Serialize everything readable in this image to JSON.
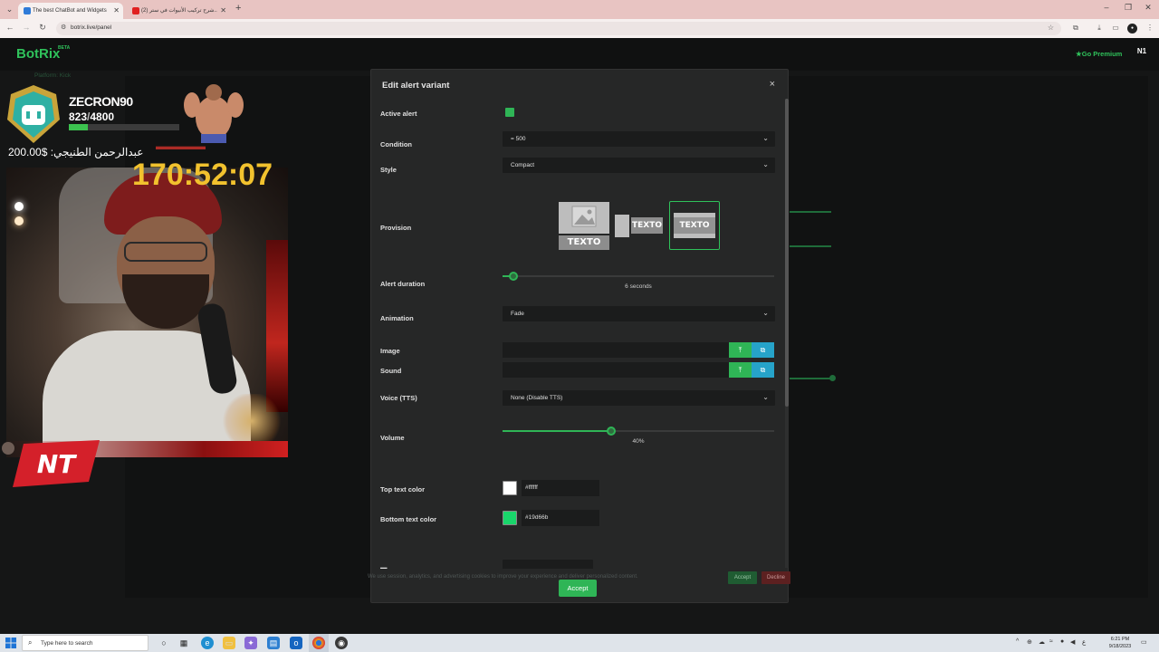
{
  "browser": {
    "tabs": [
      {
        "title": "The best ChatBot and Widgets",
        "active": true
      },
      {
        "title": "(2) شرح تركيب الأنيوات في ستر...",
        "active": false
      }
    ],
    "url": "botrix.live/panel"
  },
  "page": {
    "logo": "BotRix",
    "logo_badge": "BETA",
    "go_premium": "Go Premium",
    "platform_line": "Platform: Kick"
  },
  "stream_overlay": {
    "username": "ZECRON90",
    "xp_current": "823",
    "xp_total": "4800",
    "xp_fraction": 0.17,
    "donation": "عبدالرحمن الطنيجي: $200.00",
    "timer": "170:52:07",
    "nt_logo": "NT"
  },
  "modal": {
    "title": "Edit alert variant",
    "close": "×",
    "active_alert_label": "Active alert",
    "condition_label": "Condition",
    "condition_value": "= 500",
    "style_label": "Style",
    "style_value": "Compact",
    "provision_label": "Provision",
    "provision_text": "TEXTO",
    "alert_duration_label": "Alert duration",
    "alert_duration_value": "6 seconds",
    "alert_duration_fraction": 0.04,
    "animation_label": "Animation",
    "animation_value": "Fade",
    "image_label": "Image",
    "sound_label": "Sound",
    "voice_label": "Voice (TTS)",
    "voice_value": "None (Disable TTS)",
    "volume_label": "Volume",
    "volume_value": "40%",
    "volume_fraction": 0.4,
    "top_text_color_label": "Top text color",
    "top_text_color_value": "#ffffff",
    "bottom_text_color_label": "Bottom text color",
    "bottom_text_color_value": "#19d66b",
    "accept_button": "Accept"
  },
  "cookie_bar": {
    "text": "We use session, analytics, and advertising cookies to improve your experience and deliver personalized content.",
    "accept": "Accept",
    "decline": "Decline"
  },
  "taskbar": {
    "search_placeholder": "Type here to search",
    "time": "6:21 PM",
    "date": "9/18/2023"
  },
  "colors": {
    "accent_green": "#2fb556",
    "gallery_blue": "#26a3c9",
    "timer_yellow": "#f2c22e",
    "top_text_color": "#ffffff",
    "bottom_text_color": "#19d66b"
  }
}
